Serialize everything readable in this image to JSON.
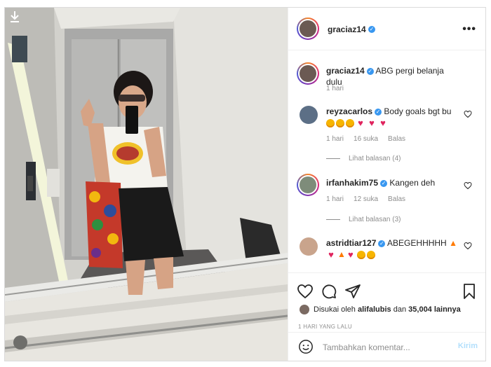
{
  "post": {
    "username": "graciaz14",
    "verified_glyph": "✓",
    "more_glyph": "•••",
    "caption": "ABG pergi belanja dulu",
    "caption_time": "1 hari"
  },
  "comments": [
    {
      "username": "reyzacarlos",
      "text": "Body goals bgt bu",
      "emoji": [
        "heart-eyes",
        "heart-eyes",
        "heart-eyes",
        "red-heart",
        "red-heart",
        "red-heart"
      ],
      "time": "1 hari",
      "likes": "16 suka",
      "reply": "Balas",
      "view_replies": "Lihat balasan (4)"
    },
    {
      "username": "irfanhakim75",
      "text": "Kangen deh",
      "time": "1 hari",
      "likes": "12 suka",
      "reply": "Balas",
      "view_replies": "Lihat balasan (3)"
    },
    {
      "username": "astridtiar127",
      "text": "ABEGEHHHHH",
      "emoji": [
        "fire",
        "red-heart",
        "fire",
        "red-heart",
        "heart-eyes",
        "heart-eyes"
      ]
    }
  ],
  "likes": {
    "prefix": "Disukai oleh",
    "user": "alifalubis",
    "middle": "dan",
    "count": "35,004 lainnya"
  },
  "timestamp": "1 HARI YANG LALU",
  "composer": {
    "placeholder": "Tambahkan komentar...",
    "send_label": "Kirim"
  },
  "icons": [
    "download-icon",
    "more-options-icon",
    "like-heart-icon",
    "comment-icon",
    "share-icon",
    "bookmark-icon",
    "emoji-icon"
  ],
  "colors": {
    "verified": "#3897f0",
    "send_disabled": "#b2dffc",
    "heart": "#e0245e"
  }
}
